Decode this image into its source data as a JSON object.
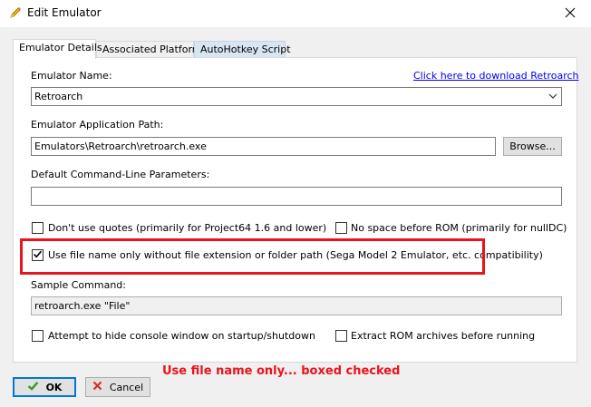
{
  "window": {
    "title": "Edit Emulator",
    "close_glyph": "✕"
  },
  "tabs": [
    {
      "label": "Emulator Details",
      "active": true
    },
    {
      "label": "Associated Platforms",
      "active": false
    },
    {
      "label": "AutoHotkey Script",
      "active": false
    }
  ],
  "form": {
    "emulator_name_label": "Emulator Name:",
    "download_link": "Click here to download Retroarch",
    "emulator_name_value": "Retroarch",
    "app_path_label": "Emulator Application Path:",
    "app_path_value": "Emulators\\Retroarch\\retroarch.exe",
    "browse_label": "Browse...",
    "cmdline_label": "Default Command-Line Parameters:",
    "cmdline_value": "",
    "dont_use_quotes": {
      "label": "Don't use quotes (primarily for Project64 1.6 and lower)",
      "checked": false
    },
    "no_space_before_rom": {
      "label": "No space before ROM (primarily for nullDC)",
      "checked": false
    },
    "use_file_name_only": {
      "label": "Use file name only without file extension or folder path (Sega Model 2 Emulator, etc. compatibility)",
      "checked": true
    },
    "sample_command_label": "Sample Command:",
    "sample_command_value": "retroarch.exe \"File\"",
    "hide_console": {
      "label": "Attempt to hide console window on startup/shutdown",
      "checked": false
    },
    "extract_rom": {
      "label": "Extract ROM archives before running",
      "checked": false
    }
  },
  "annotation": "Use file name only... boxed checked",
  "buttons": {
    "ok_label": "OK",
    "cancel_label": "Cancel"
  },
  "colors": {
    "annotation_red": "#e8141b",
    "link_blue": "#0000ee",
    "ok_check_green": "#2e9e2e",
    "cancel_x_red": "#d03030",
    "focus_blue": "#0078d7"
  },
  "icons": {
    "title": "pencil-icon",
    "ok": "checkmark-icon",
    "cancel": "x-icon"
  }
}
